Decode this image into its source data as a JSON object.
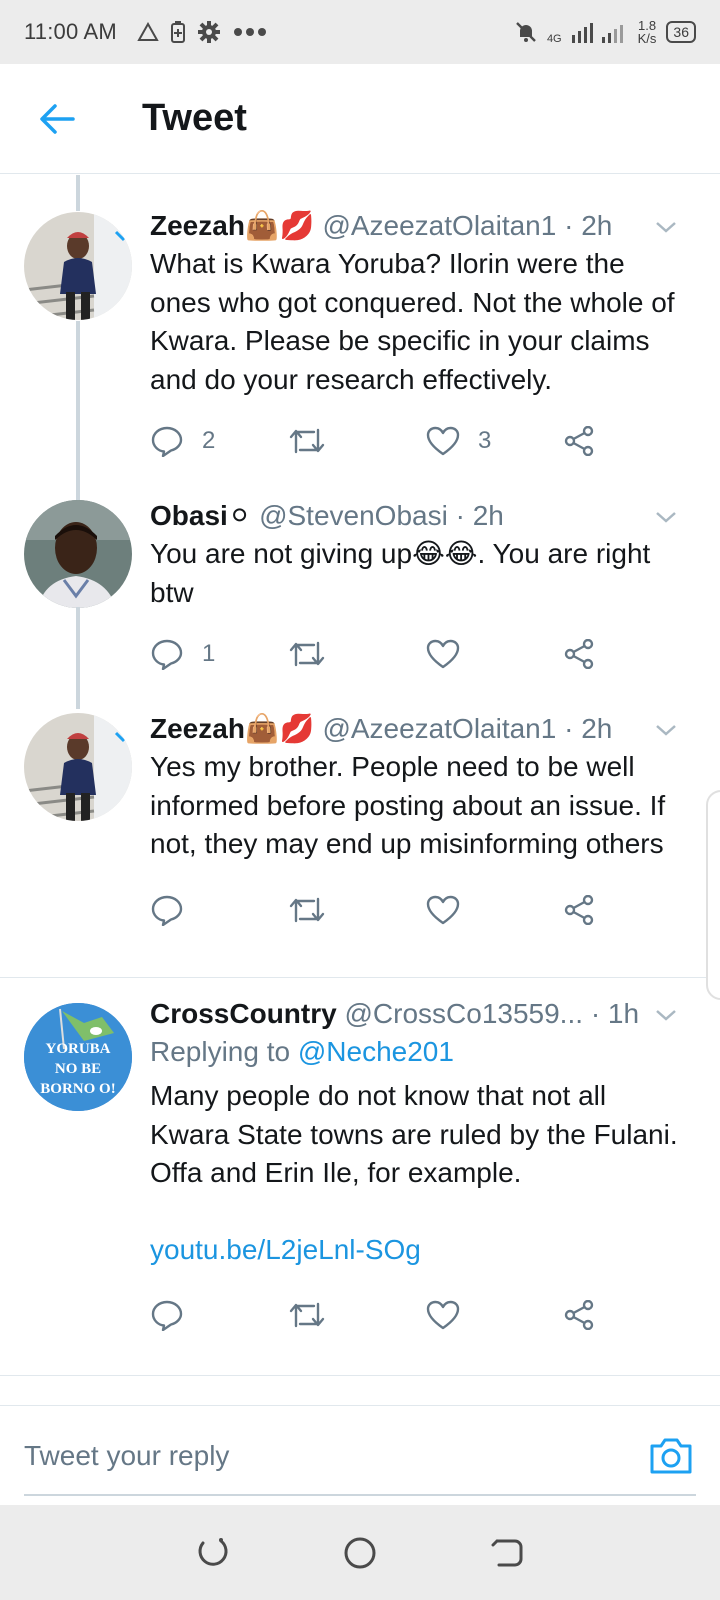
{
  "status_bar": {
    "time": "11:00 AM",
    "network": "4G",
    "speed_value": "1.8",
    "speed_unit": "K/s",
    "battery": "36"
  },
  "header": {
    "title": "Tweet"
  },
  "tweets": [
    {
      "name": "Zeezah👜💋",
      "handle": "@AzeezatOlaitan1",
      "time": "· 2h",
      "body": "What is Kwara Yoruba? Ilorin were the ones who got conquered. Not the whole of Kwara. Please be specific in your claims and do your research effectively.",
      "replies": "2",
      "retweets": "",
      "likes": "3"
    },
    {
      "name": "Obasi⚪",
      "handle": "@StevenObasi",
      "time": "· 2h",
      "body": "You are not giving up😂😂. You are right btw",
      "replies": "1",
      "retweets": "",
      "likes": ""
    },
    {
      "name": "Zeezah👜💋",
      "handle": "@AzeezatOlaitan1",
      "time": "· 2h",
      "body": "Yes my brother. People need to be well informed before posting about an issue. If not, they may end up misinforming others",
      "replies": "",
      "retweets": "",
      "likes": ""
    },
    {
      "name": "CrossCountry",
      "handle": "@CrossCo13559...",
      "time": "· 1h",
      "reply_prefix": "Replying to ",
      "reply_handle": "@Neche201",
      "body": "Many people do not know that not all Kwara State towns are ruled by the Fulani. Offa and Erin Ile, for example.",
      "link": "youtu.be/L2jeLnl-SOg",
      "avatar_text": [
        "YORUBA",
        "NO BE",
        "BORNO O!"
      ],
      "replies": "",
      "retweets": "",
      "likes": ""
    }
  ],
  "reply_box": {
    "placeholder": "Tweet your reply"
  },
  "colors": {
    "accent": "#1da1f2",
    "link": "#1b95e0",
    "secondary_text": "#657786",
    "thread_line": "#ccd6dd"
  },
  "icons": {
    "back": "arrow-left-icon",
    "reply": "speech-bubble-icon",
    "retweet": "retweet-icon",
    "like": "heart-icon",
    "share": "share-icon",
    "caret": "chevron-down-icon",
    "camera": "camera-icon"
  }
}
